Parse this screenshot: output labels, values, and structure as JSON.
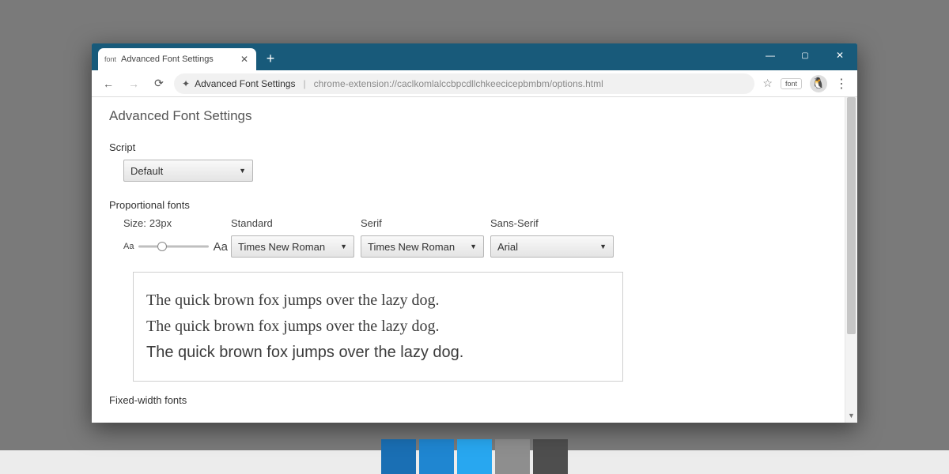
{
  "window": {
    "tab_favicon_text": "font",
    "tab_title": "Advanced Font Settings"
  },
  "toolbar": {
    "page_title": "Advanced Font Settings",
    "url": "chrome-extension://caclkomlalccbpcdllchkeecicepbmbm/options.html",
    "pill_text": "font"
  },
  "page": {
    "heading": "Advanced Font Settings",
    "script_label": "Script",
    "script_value": "Default",
    "proportional_label": "Proportional fonts",
    "size_label_prefix": "Size: ",
    "size_value": "23px",
    "columns": {
      "standard": "Standard",
      "serif": "Serif",
      "sans": "Sans-Serif"
    },
    "aa_small": "Aa",
    "aa_big": "Aa",
    "selects": {
      "standard": "Times New Roman",
      "serif": "Times New Roman",
      "sans": "Arial"
    },
    "preview_text": "The quick brown fox jumps over the lazy dog.",
    "fixed_label": "Fixed-width fonts"
  }
}
